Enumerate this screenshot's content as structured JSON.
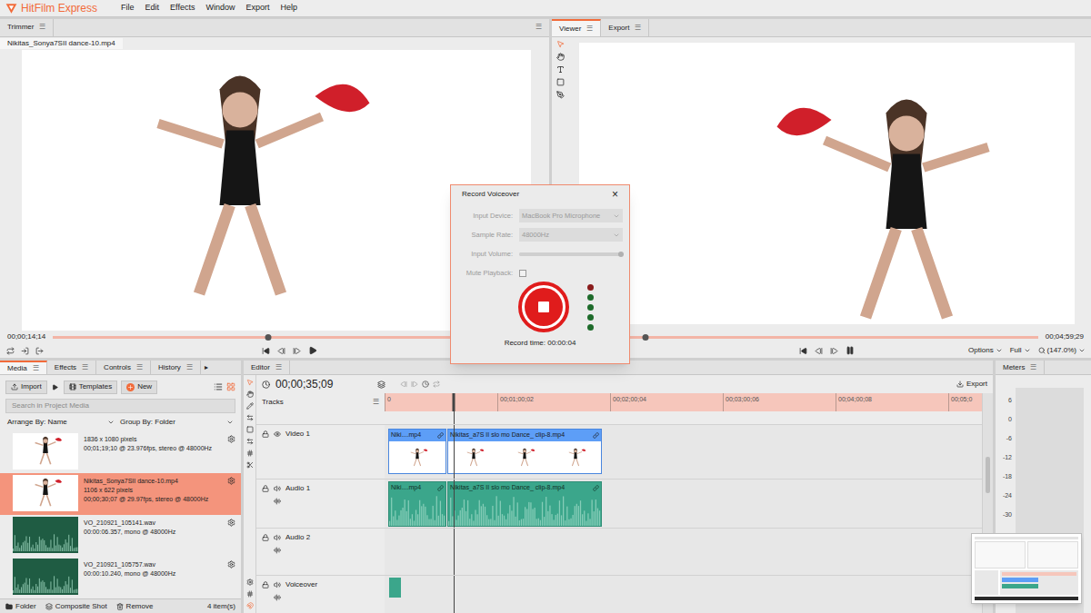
{
  "app": {
    "logo": "HitFilm Express",
    "menu": [
      "File",
      "Edit",
      "Effects",
      "Window",
      "Export",
      "Help"
    ]
  },
  "trimmer": {
    "tab": "Trimmer",
    "menu_icon": "☰",
    "file": "Nikitas_Sonya7SII dance-10.mp4",
    "time": "00;00;14;14",
    "level": 0.44
  },
  "viewer": {
    "tabs": [
      {
        "label": "Viewer",
        "selected": true
      },
      {
        "label": "Export",
        "selected": false
      }
    ],
    "menu_icon": "☰",
    "time": "00;04;59;29",
    "level": 0.18,
    "options": "Options",
    "quality": "Full",
    "zoom": "(147.0%)"
  },
  "dialog": {
    "title": "Record Voiceover",
    "close": "×",
    "fields": [
      {
        "kind": "select",
        "label": "Input Device:",
        "value": "MacBook Pro Microphone",
        "disabled": true
      },
      {
        "kind": "select",
        "label": "Sample Rate:",
        "value": "48000Hz",
        "disabled": true
      },
      {
        "kind": "slider",
        "label": "Input Volume:",
        "level": 0.98,
        "disabled": true
      },
      {
        "kind": "checkbox",
        "label": "Mute Playback:",
        "checked": false,
        "disabled": true
      }
    ],
    "recording": true,
    "meter": [
      {
        "color": "#8a1c1c"
      },
      {
        "color": "#1e6b2b"
      },
      {
        "color": "#1e6b2b"
      },
      {
        "color": "#1e6b2b"
      },
      {
        "color": "#1e6b2b"
      }
    ],
    "record_time": "Record time: 00:00:04"
  },
  "media": {
    "tabs": [
      {
        "label": "Media",
        "selected": true
      },
      {
        "label": "Effects",
        "selected": false
      },
      {
        "label": "Controls",
        "selected": false
      },
      {
        "label": "History",
        "selected": false
      }
    ],
    "tabs_more": "▸",
    "menu_icon": "☰",
    "buttons": [
      {
        "label": "Import"
      },
      {
        "label": "Templates"
      },
      {
        "label": "New"
      }
    ],
    "search": "Search in Project Media",
    "arrange": "Arrange By: Name",
    "group": "Group By: Folder",
    "items": [
      {
        "kind": "video",
        "selected": false,
        "lines": [
          "1836 x 1080 pixels",
          "00;01;19;10 @ 23.976fps, stereo @ 48000Hz"
        ]
      },
      {
        "kind": "video",
        "selected": true,
        "lines": [
          "Nikitas_Sonya7SII dance-10.mp4",
          "1106 x 622 pixels",
          "00;00;30;07 @ 29.97fps, stereo @ 48000Hz"
        ]
      },
      {
        "kind": "audio",
        "selected": false,
        "lines": [
          "VO_210921_105141.wav",
          "00:00:06.357, mono @ 48000Hz"
        ]
      },
      {
        "kind": "audio",
        "selected": false,
        "lines": [
          "VO_210921_105757.wav",
          "00:00:10.240, mono @ 48000Hz"
        ]
      }
    ],
    "footer": {
      "folder": "Folder",
      "composite": "Composite Shot",
      "remove": "Remove",
      "count": "4 item(s)"
    }
  },
  "editor": {
    "tab": "Editor",
    "menu_icon": "☰",
    "time": "00;00;35;09",
    "export": "Export",
    "tracks_label": "Tracks",
    "ruler": [
      "0",
      "00;01;00;02",
      "00;02;00;04",
      "00;03;00;06",
      "00;04;00;08",
      "00;05;0"
    ],
    "playhead": 0.115,
    "tracks": [
      {
        "name": "Video 1",
        "kind": "video",
        "clips": [
          {
            "label": "Niki....mp4"
          },
          {
            "label": "Nikitas_a7S II slo mo Dance_ clip-8.mp4"
          }
        ]
      },
      {
        "name": "Audio 1",
        "kind": "audio",
        "clips": [
          {
            "label": "Niki....mp4"
          },
          {
            "label": "Nikitas_a7S II slo mo Dance_ clip-8.mp4"
          }
        ]
      },
      {
        "name": "Audio 2",
        "kind": "audio",
        "clips": []
      },
      {
        "name": "Voiceover",
        "kind": "voiceover",
        "clips": [
          {
            "label": ""
          }
        ]
      }
    ]
  },
  "meters": {
    "title": "Meters",
    "menu_icon": "☰",
    "scale": [
      "6",
      "0",
      "-6",
      "-12",
      "-18",
      "-24",
      "-30"
    ]
  }
}
